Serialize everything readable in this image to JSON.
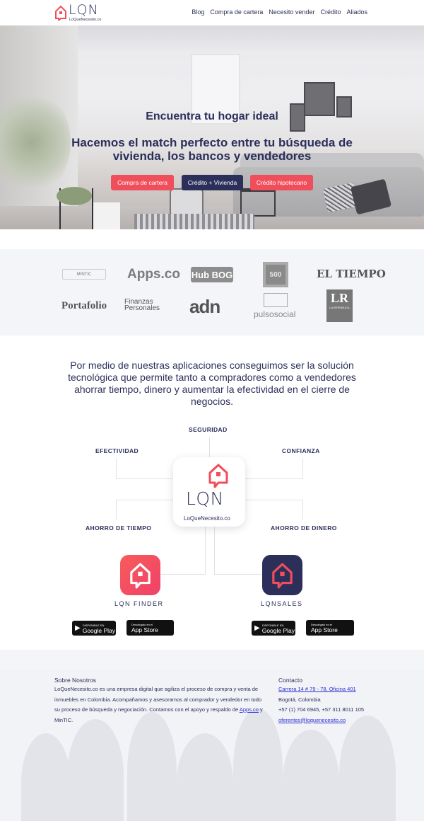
{
  "brand": {
    "logo": "LQN",
    "sub": "LoQueNecesito.co"
  },
  "nav": [
    "Blog",
    "Compra de cartera",
    "Necesito vender",
    "Crédito",
    "Aliados"
  ],
  "hero": {
    "title": "Encuentra tu hogar ideal",
    "subtitle": "Hacemos el match perfecto entre tu búsqueda de vivienda, los bancos y vendedores",
    "buttons": [
      "Compra de cartera",
      "Crédito + Vivienda",
      "Crédito hipotecario"
    ]
  },
  "partners": {
    "mintic": "MINTIC",
    "appsco": "Apps.co",
    "hubbog": "Hub BOG",
    "f500": "500",
    "eltiempo": "EL TIEMPO",
    "portafolio": "Portafolio",
    "finanzas": "Finanzas Personales",
    "adn": "adn",
    "pulso": "pulsosocial",
    "lr": "LR",
    "lr_sub": "LA REPÚBLICA"
  },
  "mission": "Por medio de nuestras aplicaciones conseguimos ser la solución tecnológica que permite tanto a compradores como a vendedores ahorrar tiempo, dinero y aumentar la efectividad en el cierre de negocios.",
  "features": {
    "seguridad": "SEGURIDAD",
    "efectividad": "EFECTIVIDAD",
    "confianza": "CONFIANZA",
    "ahorro_tiempo": "AHORRO DE TIEMPO",
    "ahorro_dinero": "AHORRO DE DINERO"
  },
  "center": {
    "logo": "LQN",
    "sub": "LoQueNecesito.co"
  },
  "apps": {
    "finder": "LQN FINDER",
    "sales": "LQNSALES"
  },
  "stores": {
    "gp_small": "DISPONIBLE EN",
    "gp_big": "Google Play",
    "as_small": "Descárgalo en el",
    "as_big": "App Store"
  },
  "footer": {
    "about_title": "Sobre Nosotros",
    "about_text": "LoQueNecesito.co es una empresa digital que agiliza el proceso de compra y venta de inmuebles en Colombia. Acompañamos y asesoramos al comprador y vendedor en todo su proceso de búsqueda y negociación. Contamos con el apoyo y respaldo de",
    "about_link": "Apps.co",
    "about_end": "y MinTIC.",
    "contact_title": "Contacto",
    "address": "Carrera 14 # 79 - 78, Oficina 401",
    "city": "Bogotá, Colombia",
    "phones": "+57 (1) 704 6945, +57 311 8011 105",
    "email": "oferentes@loquenecesito.co"
  },
  "colors": {
    "navy": "#2b2f5a",
    "red": "#f04e5a",
    "bg_light": "#f3f5f9"
  }
}
